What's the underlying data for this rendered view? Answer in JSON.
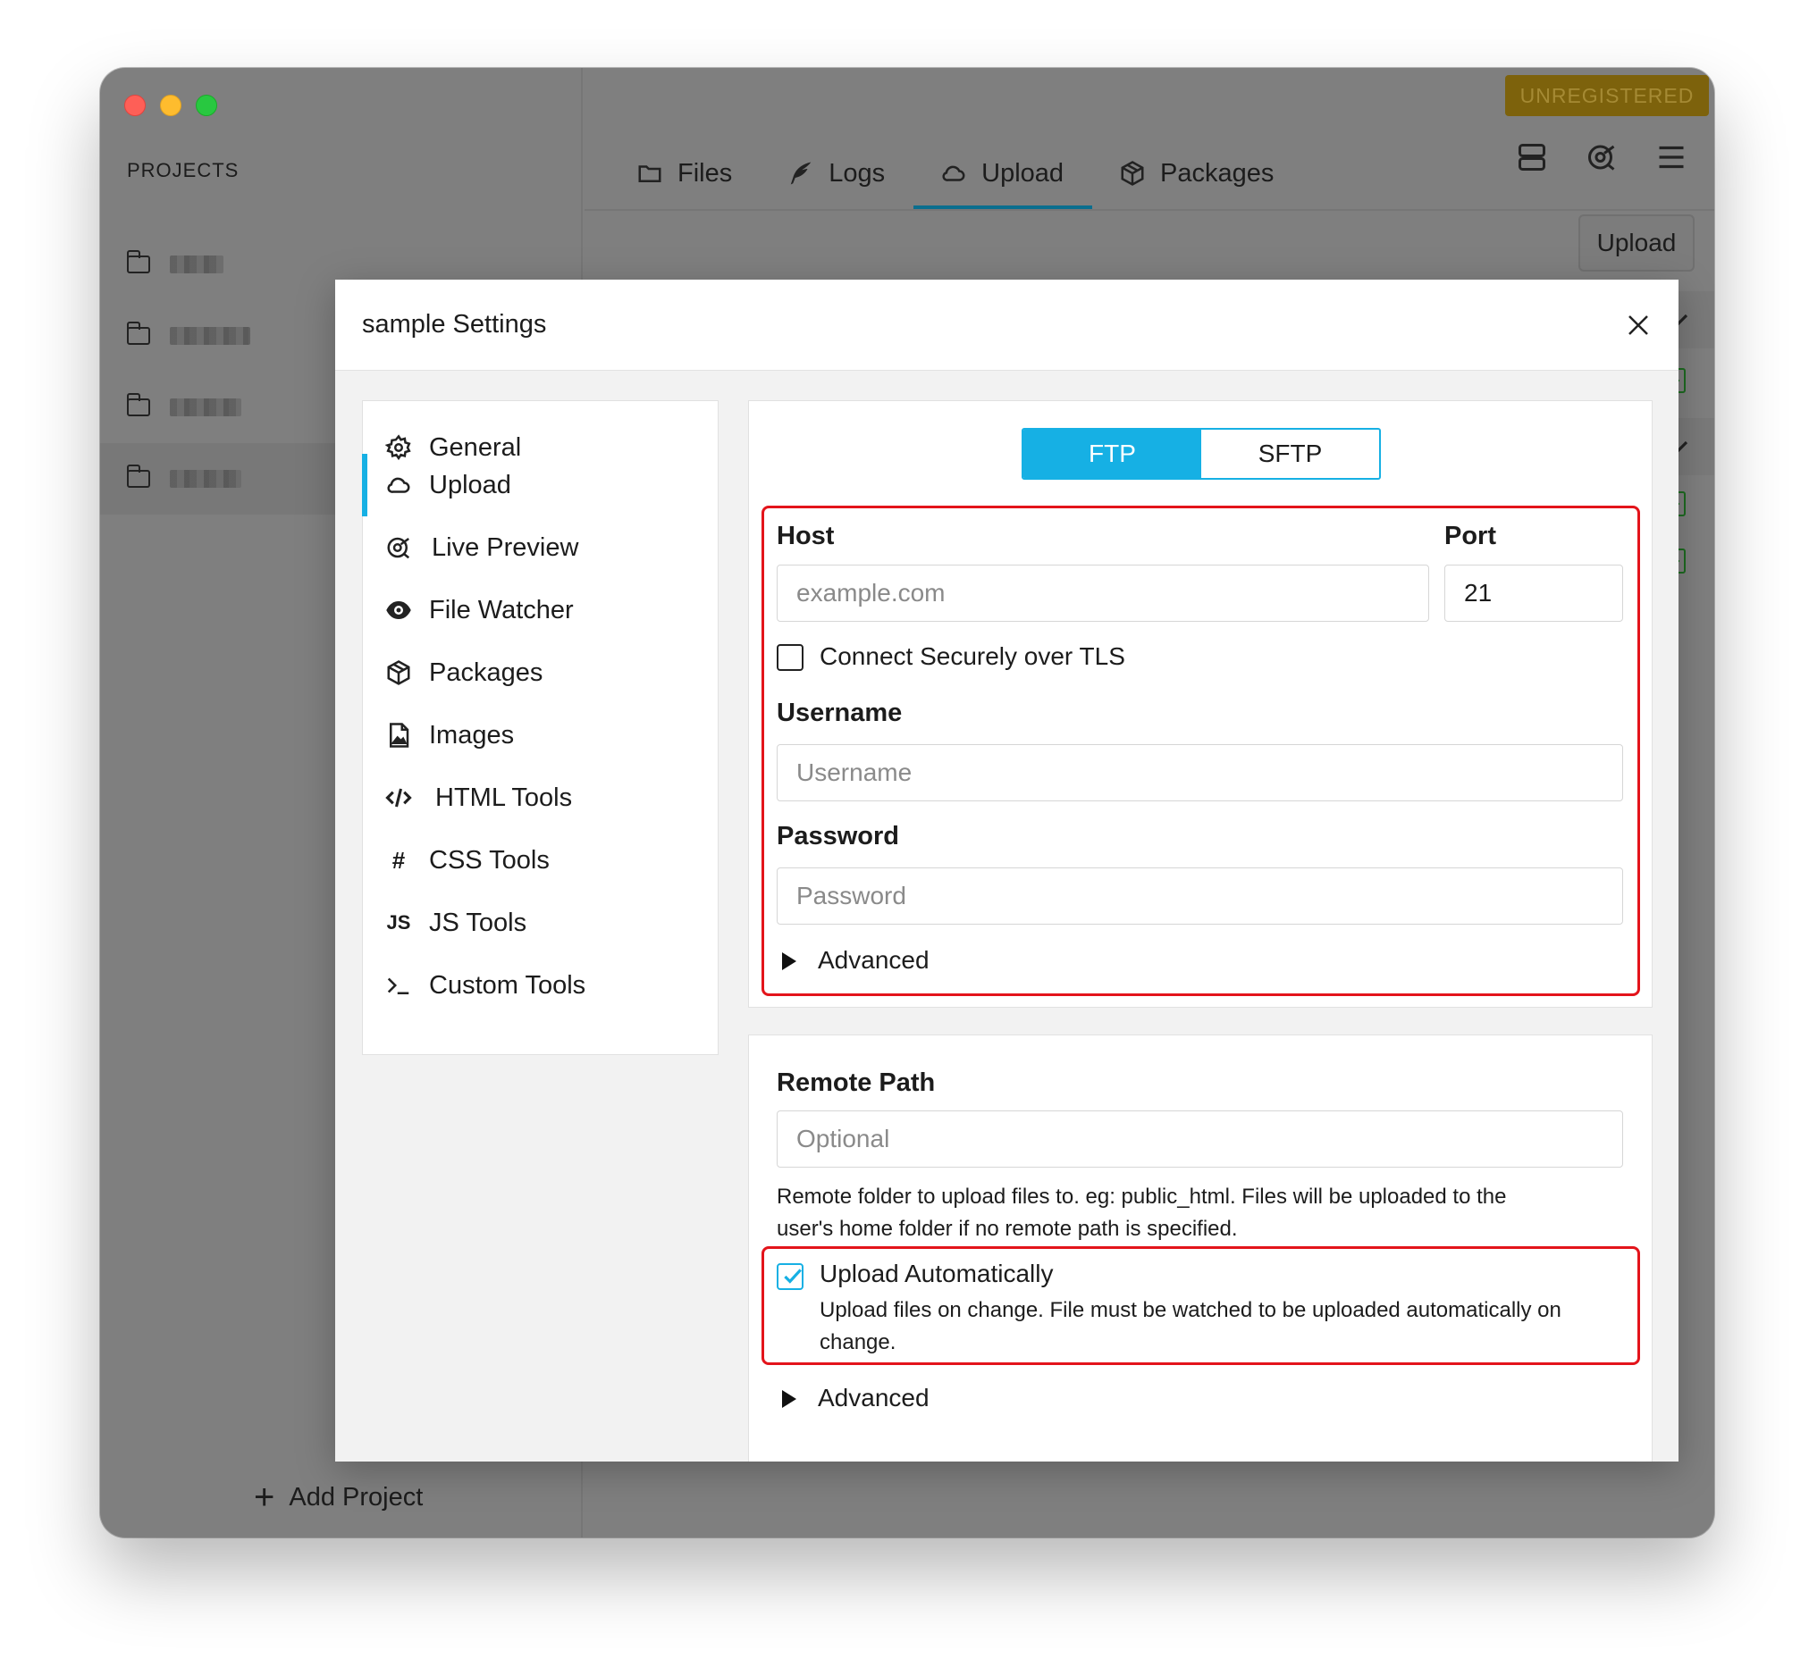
{
  "window": {
    "badge": "UNREGISTERED"
  },
  "sidebar": {
    "heading": "PROJECTS",
    "add_project_label": "Add Project",
    "project_count_visible": 4
  },
  "tabs": [
    {
      "label": "Files",
      "icon": "folder-icon"
    },
    {
      "label": "Logs",
      "icon": "feather-icon"
    },
    {
      "label": "Upload",
      "icon": "cloud-icon",
      "active": true
    },
    {
      "label": "Packages",
      "icon": "package-icon"
    }
  ],
  "toolbar": {
    "upload_label": "Upload",
    "icons": [
      "server-icon",
      "live-preview-icon",
      "menu-icon"
    ]
  },
  "modal": {
    "title": "sample Settings",
    "nav": [
      {
        "label": "General",
        "icon": "gear-icon"
      },
      {
        "label": "Upload",
        "icon": "cloud-icon",
        "active": true
      },
      {
        "label": "Live Preview",
        "icon": "live-preview-icon"
      },
      {
        "label": "File Watcher",
        "icon": "eye-icon"
      },
      {
        "label": "Packages",
        "icon": "package-icon"
      },
      {
        "label": "Images",
        "icon": "image-icon"
      },
      {
        "label": "HTML Tools",
        "icon": "code-icon"
      },
      {
        "label": "CSS Tools",
        "icon": "hash-icon"
      },
      {
        "label": "JS Tools",
        "icon": "js-icon"
      },
      {
        "label": "Custom Tools",
        "icon": "terminal-icon"
      }
    ],
    "protocol": {
      "options": [
        "FTP",
        "SFTP"
      ],
      "selected": "FTP"
    },
    "connection": {
      "host_label": "Host",
      "host_placeholder": "example.com",
      "port_label": "Port",
      "port_value": "21",
      "tls_label": "Connect Securely over TLS",
      "tls_checked": false,
      "username_label": "Username",
      "username_placeholder": "Username",
      "password_label": "Password",
      "password_placeholder": "Password",
      "advanced_label": "Advanced"
    },
    "remote": {
      "label": "Remote Path",
      "placeholder": "Optional",
      "help_line1": "Remote folder to upload files to. eg: public_html. Files will be uploaded to the",
      "help_line2": "user's home folder if no remote path is specified.",
      "auto_label": "Upload Automatically",
      "auto_checked": true,
      "auto_help_line1": "Upload files on change. File must be watched to be uploaded automatically on",
      "auto_help_line2": "change.",
      "advanced_label": "Advanced"
    }
  },
  "colors": {
    "accent": "#16b0e4",
    "highlight": "#e3141b",
    "badge_bg": "#7d620c",
    "window_bg": "#7f7f7f"
  }
}
